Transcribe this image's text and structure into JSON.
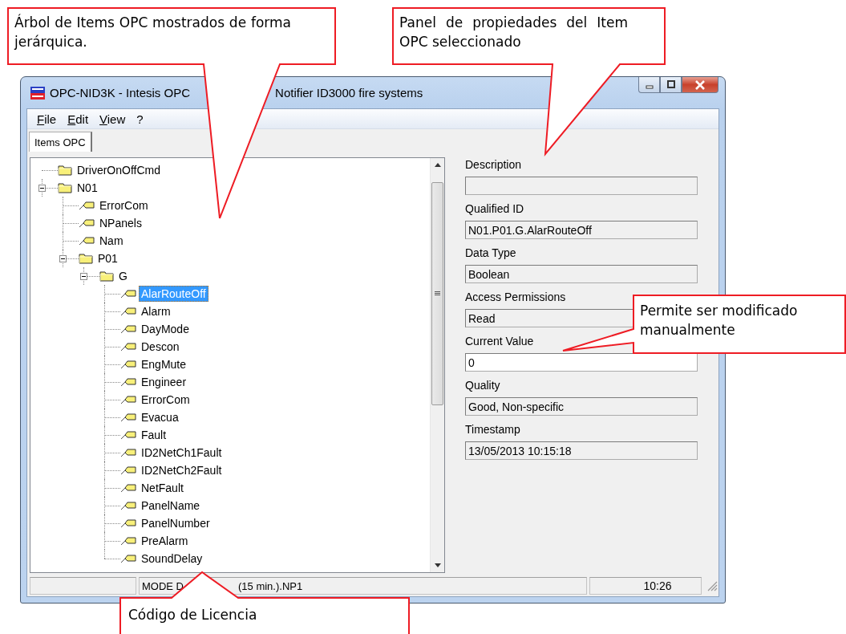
{
  "window": {
    "title_parts": [
      "OPC-NID3K - Intesis OPC",
      "Notifier ID3000 fire systems"
    ]
  },
  "menu": [
    "File",
    "Edit",
    "View",
    "?"
  ],
  "tabs": [
    {
      "label": "Items OPC",
      "selected": true
    }
  ],
  "tree": [
    {
      "label": "DriverOnOffCmd",
      "kind": "folder",
      "selected": false
    },
    {
      "label": "N01",
      "kind": "folder",
      "expanded": true,
      "selected": false,
      "children": [
        {
          "label": "ErrorCom",
          "kind": "item",
          "selected": false
        },
        {
          "label": "NPanels",
          "kind": "item",
          "selected": false
        },
        {
          "label": "Nam",
          "kind": "item",
          "selected": false
        },
        {
          "label": "P01",
          "kind": "folder",
          "expanded": true,
          "selected": false,
          "children": [
            {
              "label": "G",
              "kind": "folder",
              "expanded": true,
              "selected": false,
              "children": [
                {
                  "label": "AlarRouteOff",
                  "kind": "item",
                  "selected": true
                },
                {
                  "label": "Alarm",
                  "kind": "item",
                  "selected": false
                },
                {
                  "label": "DayMode",
                  "kind": "item",
                  "selected": false
                },
                {
                  "label": "Descon",
                  "kind": "item",
                  "selected": false
                },
                {
                  "label": "EngMute",
                  "kind": "item",
                  "selected": false
                },
                {
                  "label": "Engineer",
                  "kind": "item",
                  "selected": false
                },
                {
                  "label": "ErrorCom",
                  "kind": "item",
                  "selected": false
                },
                {
                  "label": "Evacua",
                  "kind": "item",
                  "selected": false
                },
                {
                  "label": "Fault",
                  "kind": "item",
                  "selected": false
                },
                {
                  "label": "ID2NetCh1Fault",
                  "kind": "item",
                  "selected": false
                },
                {
                  "label": "ID2NetCh2Fault",
                  "kind": "item",
                  "selected": false
                },
                {
                  "label": "NetFault",
                  "kind": "item",
                  "selected": false
                },
                {
                  "label": "PanelName",
                  "kind": "item",
                  "selected": false
                },
                {
                  "label": "PanelNumber",
                  "kind": "item",
                  "selected": false
                },
                {
                  "label": "PreAlarm",
                  "kind": "item",
                  "selected": false
                },
                {
                  "label": "SoundDelay",
                  "kind": "item",
                  "selected": false
                }
              ]
            }
          ]
        }
      ]
    }
  ],
  "properties": [
    {
      "label": "Description",
      "editable": false
    },
    {
      "label": "Qualified ID",
      "value": "N01.P01.G.AlarRouteOff",
      "editable": false
    },
    {
      "label": "Data Type",
      "value": "Boolean",
      "editable": false
    },
    {
      "label": "Access Permissions",
      "value": "Read",
      "editable": false
    },
    {
      "label": "Current Value",
      "value": "0",
      "editable": true
    },
    {
      "label": "Quality",
      "value": "Good, Non-specific",
      "editable": false
    },
    {
      "label": "Timestamp",
      "value": "13/05/2013 10:15:18",
      "editable": false
    }
  ],
  "status_bar": {
    "license_parts": [
      "MODE D",
      "(15 min.).NP1"
    ],
    "time": "10:26"
  },
  "callouts": [
    {
      "text": "Árbol de Items OPC mostrados de forma jerárquica."
    },
    {
      "text": "Panel de propiedades del Item OPC seleccionado"
    },
    {
      "text": "Permite ser modificado manualmente"
    },
    {
      "text": "Código de Licencia"
    }
  ]
}
